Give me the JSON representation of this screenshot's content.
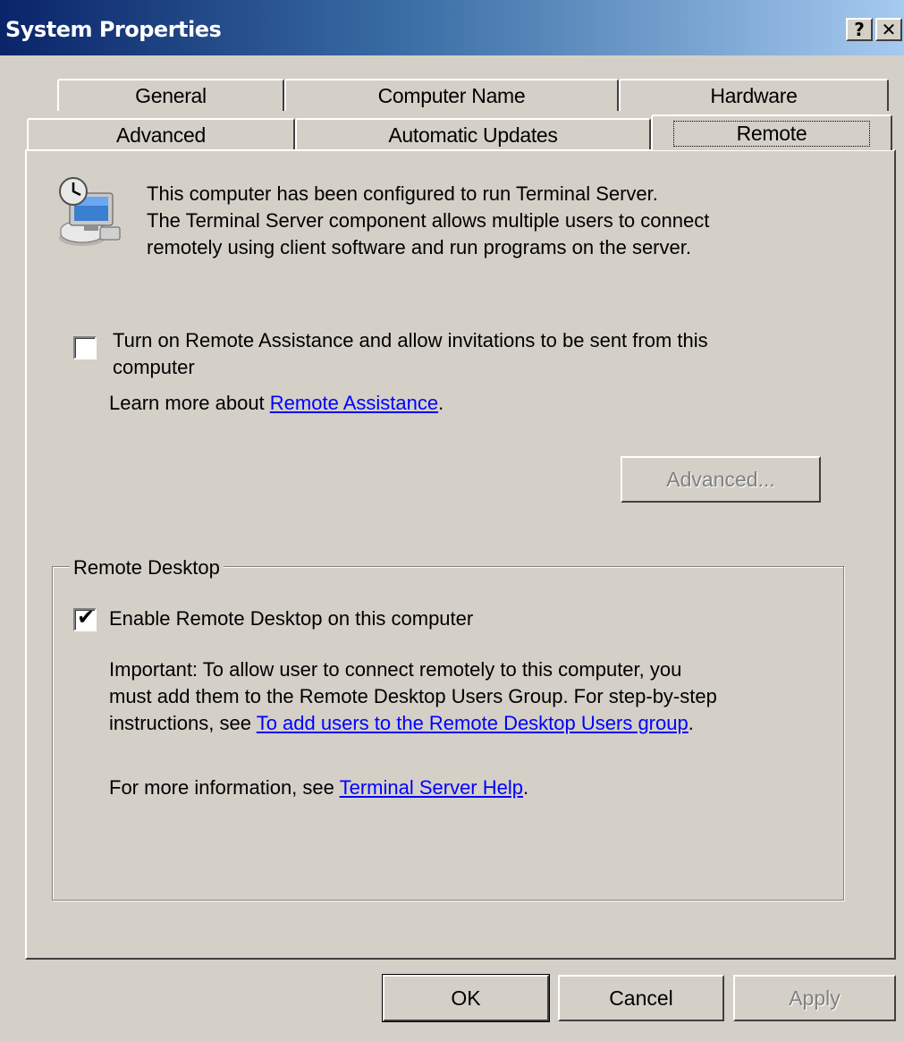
{
  "window": {
    "title": "System Properties",
    "help_button": "?",
    "close_button": "✕"
  },
  "tabs": {
    "row1": [
      "General",
      "Computer Name",
      "Hardware"
    ],
    "row2": [
      "Advanced",
      "Automatic Updates",
      "Remote"
    ],
    "selected": "Remote"
  },
  "intro": {
    "icon": "terminal-server-icon",
    "lines": [
      "This computer has been configured to run Terminal Server.",
      "The Terminal Server component allows multiple users to connect",
      "remotely using client software and run programs on the server."
    ]
  },
  "remote_assistance": {
    "checkbox_line1": "Turn on Remote Assistance and allow invitations to be sent from this",
    "checkbox_line2": "computer",
    "checked": false,
    "learn_prefix": "Learn more about ",
    "learn_link": "Remote Assistance",
    "learn_suffix": ".",
    "advanced_button": "Advanced...",
    "advanced_enabled": false
  },
  "remote_desktop": {
    "group_label": "Remote Desktop",
    "checkbox_label": "Enable Remote Desktop on this computer",
    "checked": true,
    "important_line1": "Important: To allow user to connect remotely to this computer, you",
    "important_line2": "must add them to the Remote Desktop Users Group. For step-by-step",
    "important_line3_prefix": "instructions, see ",
    "important_link": "To add users to the Remote Desktop Users group",
    "important_suffix": ".",
    "info_prefix": "For more information, see ",
    "info_link": "Terminal Server Help",
    "info_suffix": "."
  },
  "buttons": {
    "ok": "OK",
    "cancel": "Cancel",
    "apply": "Apply",
    "apply_enabled": false
  }
}
